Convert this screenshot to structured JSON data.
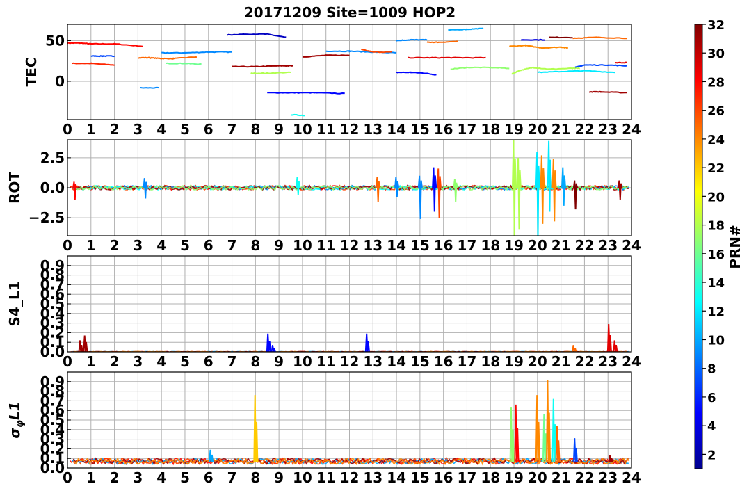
{
  "title": "20171209 Site=1009 HOP2",
  "colorbar": {
    "label": "PRN#",
    "min": 1,
    "max": 32,
    "ticks": [
      2,
      4,
      6,
      8,
      10,
      12,
      14,
      16,
      18,
      20,
      22,
      24,
      26,
      28,
      30,
      32
    ]
  },
  "chart_data": [
    {
      "type": "line",
      "ylabel": "TEC",
      "xlim": [
        0,
        24
      ],
      "ylim": [
        -47,
        70
      ],
      "yticks": [
        0,
        50
      ],
      "xticks": [
        0,
        1,
        2,
        3,
        4,
        5,
        6,
        7,
        8,
        9,
        10,
        11,
        12,
        13,
        14,
        15,
        16,
        17,
        18,
        19,
        20,
        21,
        22,
        23,
        24
      ],
      "grid": true,
      "series": [
        {
          "prn": 28,
          "segments": [
            [
              0.0,
              47
            ],
            [
              0.5,
              47
            ],
            [
              1.0,
              46
            ],
            [
              2.0,
              46
            ],
            [
              3.2,
              43
            ]
          ]
        },
        {
          "prn": 27,
          "segments": [
            [
              0.2,
              22
            ],
            [
              1.0,
              22
            ],
            [
              2.0,
              20
            ]
          ]
        },
        {
          "prn": 7,
          "segments": [
            [
              1.0,
              31
            ],
            [
              1.5,
              31
            ],
            [
              2.0,
              31
            ]
          ]
        },
        {
          "prn": 25,
          "segments": [
            [
              3.0,
              29
            ],
            [
              3.5,
              29
            ],
            [
              4.0,
              28
            ],
            [
              4.5,
              28
            ],
            [
              5.5,
              30
            ]
          ]
        },
        {
          "prn": 9,
          "segments": [
            [
              3.1,
              -8
            ],
            [
              3.9,
              -8
            ]
          ]
        },
        {
          "prn": 9,
          "segments": [
            [
              4.0,
              35
            ],
            [
              5.0,
              35
            ],
            [
              6.0,
              36
            ],
            [
              7.0,
              36
            ]
          ]
        },
        {
          "prn": 16,
          "segments": [
            [
              4.2,
              22
            ],
            [
              5.0,
              22
            ],
            [
              5.7,
              21
            ]
          ]
        },
        {
          "prn": 3,
          "segments": [
            [
              6.8,
              57
            ],
            [
              7.5,
              58
            ],
            [
              8.5,
              58
            ],
            [
              9.3,
              54
            ]
          ]
        },
        {
          "prn": 31,
          "segments": [
            [
              7.0,
              18
            ],
            [
              8.0,
              18
            ],
            [
              9.0,
              19
            ],
            [
              9.6,
              19
            ]
          ]
        },
        {
          "prn": 18,
          "segments": [
            [
              7.8,
              10
            ],
            [
              8.5,
              10
            ],
            [
              9.5,
              11
            ]
          ]
        },
        {
          "prn": 5,
          "segments": [
            [
              8.5,
              -14
            ],
            [
              9.5,
              -14
            ],
            [
              10.5,
              -14
            ],
            [
              11.8,
              -15
            ]
          ]
        },
        {
          "prn": 13,
          "segments": [
            [
              9.5,
              -41
            ],
            [
              10.1,
              -42
            ]
          ]
        },
        {
          "prn": 31,
          "segments": [
            [
              10.0,
              30
            ],
            [
              11.0,
              32
            ],
            [
              12.0,
              32
            ]
          ]
        },
        {
          "prn": 9,
          "segments": [
            [
              11.0,
              37
            ],
            [
              12.0,
              37
            ],
            [
              13.0,
              36
            ],
            [
              14.0,
              35
            ]
          ]
        },
        {
          "prn": 26,
          "segments": [
            [
              12.5,
              39
            ],
            [
              13.0,
              36
            ],
            [
              13.8,
              36
            ]
          ]
        },
        {
          "prn": 5,
          "segments": [
            [
              14.0,
              11
            ],
            [
              14.6,
              11
            ],
            [
              15.2,
              10
            ],
            [
              15.7,
              8
            ]
          ]
        },
        {
          "prn": 9,
          "segments": [
            [
              14.0,
              50
            ],
            [
              14.6,
              51
            ],
            [
              15.3,
              51
            ]
          ]
        },
        {
          "prn": 29,
          "segments": [
            [
              14.5,
              29
            ],
            [
              15.5,
              29
            ],
            [
              16.5,
              29
            ],
            [
              17.8,
              29
            ]
          ]
        },
        {
          "prn": 25,
          "segments": [
            [
              15.3,
              48
            ],
            [
              15.8,
              48
            ],
            [
              16.6,
              49
            ]
          ]
        },
        {
          "prn": 10,
          "segments": [
            [
              16.2,
              63
            ],
            [
              17.0,
              64
            ],
            [
              17.7,
              65
            ]
          ]
        },
        {
          "prn": 17,
          "segments": [
            [
              16.3,
              15
            ],
            [
              17.0,
              17
            ],
            [
              18.0,
              17
            ],
            [
              18.8,
              16
            ]
          ]
        },
        {
          "prn": 18,
          "segments": [
            [
              18.9,
              9
            ],
            [
              19.2,
              13
            ],
            [
              19.8,
              17
            ],
            [
              20.5,
              15
            ],
            [
              21.5,
              16
            ],
            [
              21.8,
              16
            ]
          ]
        },
        {
          "prn": 24,
          "segments": [
            [
              18.8,
              43
            ],
            [
              19.5,
              44
            ],
            [
              20.2,
              41
            ],
            [
              21.0,
              42
            ],
            [
              21.3,
              41
            ]
          ]
        },
        {
          "prn": 4,
          "segments": [
            [
              19.3,
              51
            ],
            [
              20.3,
              51
            ]
          ]
        },
        {
          "prn": 32,
          "segments": [
            [
              20.5,
              54
            ],
            [
              21.5,
              54
            ]
          ]
        },
        {
          "prn": 12,
          "segments": [
            [
              20.0,
              11
            ],
            [
              21.0,
              12
            ],
            [
              22.0,
              13
            ],
            [
              23.3,
              11
            ]
          ]
        },
        {
          "prn": 25,
          "segments": [
            [
              21.5,
              53
            ],
            [
              22.5,
              54
            ],
            [
              23.8,
              53
            ]
          ]
        },
        {
          "prn": 7,
          "segments": [
            [
              21.6,
              17
            ],
            [
              22.0,
              20
            ],
            [
              23.0,
              20
            ],
            [
              23.8,
              19
            ]
          ]
        },
        {
          "prn": 31,
          "segments": [
            [
              22.2,
              -13
            ],
            [
              22.7,
              -13
            ],
            [
              23.8,
              -14
            ]
          ]
        },
        {
          "prn": 29,
          "segments": [
            [
              23.3,
              23
            ],
            [
              23.8,
              23
            ]
          ]
        }
      ]
    },
    {
      "type": "line",
      "ylabel": "ROT",
      "xlim": [
        0,
        24
      ],
      "ylim": [
        -4,
        4
      ],
      "yticks": [
        -2.5,
        0.0,
        2.5
      ],
      "ytick_labels": [
        "−2.5",
        "0.0",
        "2.5"
      ],
      "xticks": [
        0,
        1,
        2,
        3,
        4,
        5,
        6,
        7,
        8,
        9,
        10,
        11,
        12,
        13,
        14,
        15,
        16,
        17,
        18,
        19,
        20,
        21,
        22,
        23,
        24
      ],
      "grid": true,
      "spikes": [
        {
          "prn": 28,
          "x": 0.3,
          "lo": -1.0,
          "hi": 0.5
        },
        {
          "prn": 9,
          "x": 3.3,
          "lo": -0.9,
          "hi": 0.8
        },
        {
          "prn": 13,
          "x": 9.8,
          "lo": -0.6,
          "hi": 0.9
        },
        {
          "prn": 25,
          "x": 13.2,
          "lo": -1.2,
          "hi": 0.9
        },
        {
          "prn": 9,
          "x": 14.0,
          "lo": -0.8,
          "hi": 0.9
        },
        {
          "prn": 9,
          "x": 15.0,
          "lo": -2.6,
          "hi": 1.0
        },
        {
          "prn": 5,
          "x": 15.6,
          "lo": -2.0,
          "hi": 1.7
        },
        {
          "prn": 26,
          "x": 15.8,
          "lo": -2.5,
          "hi": 1.6
        },
        {
          "prn": 17,
          "x": 16.5,
          "lo": -1.2,
          "hi": 0.7
        },
        {
          "prn": 18,
          "x": 19.0,
          "lo": -4.0,
          "hi": 4.0
        },
        {
          "prn": 18,
          "x": 19.2,
          "lo": -3.5,
          "hi": 2.5
        },
        {
          "prn": 24,
          "x": 20.2,
          "lo": -3.0,
          "hi": 2.7
        },
        {
          "prn": 12,
          "x": 20.0,
          "lo": -4.0,
          "hi": 3.0
        },
        {
          "prn": 12,
          "x": 20.5,
          "lo": -2.0,
          "hi": 3.9
        },
        {
          "prn": 24,
          "x": 20.7,
          "lo": -2.8,
          "hi": 2.4
        },
        {
          "prn": 10,
          "x": 21.1,
          "lo": -1.5,
          "hi": 1.7
        },
        {
          "prn": 32,
          "x": 21.6,
          "lo": -1.8,
          "hi": 0.6
        },
        {
          "prn": 31,
          "x": 23.5,
          "lo": -1.0,
          "hi": 0.6
        }
      ]
    },
    {
      "type": "line",
      "ylabel": "S4_L1",
      "xlim": [
        0,
        24
      ],
      "ylim": [
        0,
        1.0
      ],
      "yticks": [
        0.0,
        0.1,
        0.2,
        0.3,
        0.4,
        0.5,
        0.6,
        0.7,
        0.8,
        0.9
      ],
      "ytick_labels": [
        "0.0",
        "0.1",
        "0.2",
        "0.3",
        "0.4",
        "0.5",
        "0.6",
        "0.7",
        "0.8",
        "0.9"
      ],
      "xticks": [
        0,
        1,
        2,
        3,
        4,
        5,
        6,
        7,
        8,
        9,
        10,
        11,
        12,
        13,
        14,
        15,
        16,
        17,
        18,
        19,
        20,
        21,
        22,
        23,
        24
      ],
      "grid": true,
      "baseline": 0.0,
      "spikes": [
        {
          "prn": 31,
          "x": 0.55,
          "hi": 0.12
        },
        {
          "prn": 31,
          "x": 0.75,
          "hi": 0.17
        },
        {
          "prn": 5,
          "x": 8.55,
          "hi": 0.19
        },
        {
          "prn": 5,
          "x": 8.75,
          "hi": 0.07
        },
        {
          "prn": 5,
          "x": 12.75,
          "hi": 0.19
        },
        {
          "prn": 25,
          "x": 21.55,
          "hi": 0.07
        },
        {
          "prn": 29,
          "x": 23.05,
          "hi": 0.29
        },
        {
          "prn": 29,
          "x": 23.3,
          "hi": 0.12
        }
      ]
    },
    {
      "type": "line",
      "ylabel": "σφL1",
      "ylabel_main": "σ",
      "ylabel_sub": "φ",
      "ylabel_tail": "L1",
      "xlim": [
        0,
        24
      ],
      "ylim": [
        0,
        1.0
      ],
      "yticks": [
        0.0,
        0.1,
        0.2,
        0.3,
        0.4,
        0.5,
        0.6,
        0.7,
        0.8,
        0.9
      ],
      "ytick_labels": [
        "0.0",
        "0.1",
        "0.2",
        "0.3",
        "0.4",
        "0.5",
        "0.6",
        "0.7",
        "0.8",
        "0.9"
      ],
      "xticks": [
        0,
        1,
        2,
        3,
        4,
        5,
        6,
        7,
        8,
        9,
        10,
        11,
        12,
        13,
        14,
        15,
        16,
        17,
        18,
        19,
        20,
        21,
        22,
        23,
        24
      ],
      "grid": true,
      "baseline": 0.06,
      "spikes": [
        {
          "prn": 10,
          "x": 6.1,
          "hi": 0.19
        },
        {
          "prn": 22,
          "x": 8.0,
          "hi": 0.76
        },
        {
          "prn": 17,
          "x": 18.9,
          "hi": 0.63
        },
        {
          "prn": 28,
          "x": 19.1,
          "hi": 0.66
        },
        {
          "prn": 24,
          "x": 20.0,
          "hi": 0.76
        },
        {
          "prn": 16,
          "x": 20.3,
          "hi": 0.56
        },
        {
          "prn": 24,
          "x": 20.45,
          "hi": 0.92
        },
        {
          "prn": 13,
          "x": 20.7,
          "hi": 0.72
        },
        {
          "prn": 25,
          "x": 20.85,
          "hi": 0.44
        },
        {
          "prn": 7,
          "x": 21.6,
          "hi": 0.31
        },
        {
          "prn": 31,
          "x": 23.1,
          "hi": 0.13
        }
      ]
    }
  ]
}
